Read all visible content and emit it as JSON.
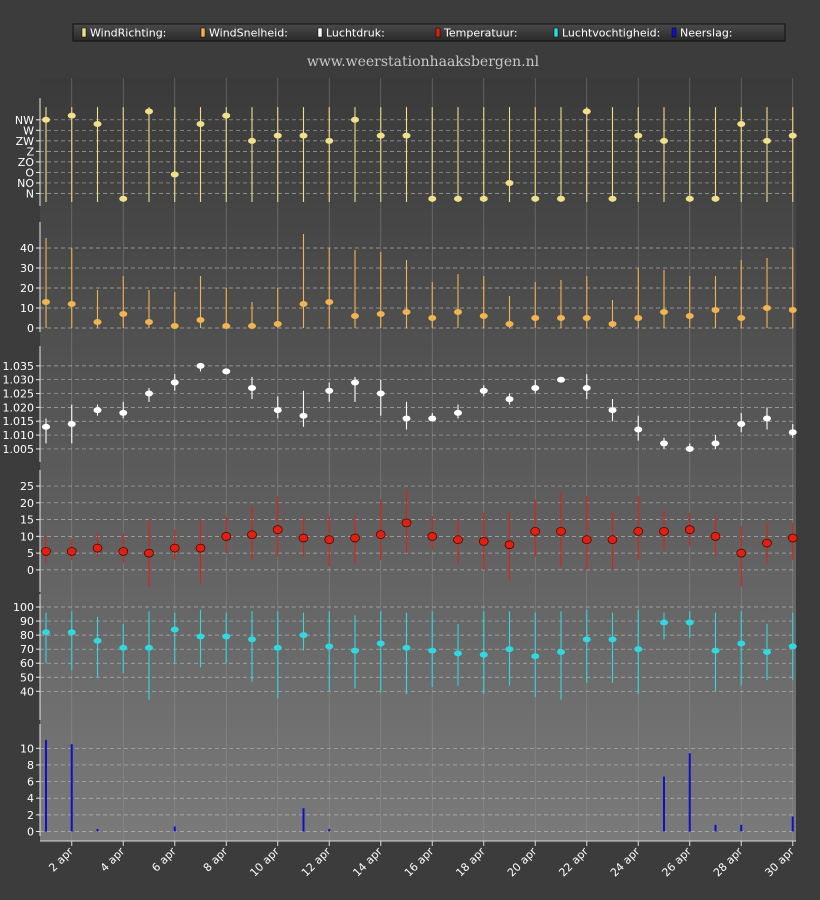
{
  "site_title": "www.weerstationhaaksbergen.nl",
  "legend": [
    {
      "label": "WindRichting:",
      "color": "#f0e08a"
    },
    {
      "label": "WindSnelheid:",
      "color": "#f2b450"
    },
    {
      "label": "Luchtdruk:",
      "color": "#ffffff"
    },
    {
      "label": "Temperatuur:",
      "color": "#e02010"
    },
    {
      "label": "Luchtvochtigheid:",
      "color": "#30d8e0"
    },
    {
      "label": "Neerslag:",
      "color": "#1010c8"
    }
  ],
  "chart_data": [
    {
      "type": "scatter",
      "name": "WindRichting",
      "x": [
        1,
        2,
        3,
        4,
        5,
        6,
        7,
        8,
        9,
        10,
        11,
        12,
        13,
        14,
        15,
        16,
        17,
        18,
        19,
        20,
        21,
        22,
        23,
        24,
        25,
        26,
        27,
        28,
        29,
        30
      ],
      "y_categories": [
        "N",
        "NO",
        "O",
        "ZO",
        "Z",
        "ZW",
        "W",
        "NW"
      ],
      "values": [
        7.0,
        7.4,
        6.6,
        -0.5,
        7.8,
        1.8,
        6.6,
        7.4,
        5.0,
        5.5,
        5.5,
        5.0,
        7.0,
        5.5,
        5.5,
        -0.5,
        -0.5,
        -0.5,
        1.0,
        -0.5,
        -0.5,
        7.8,
        -0.5,
        5.5,
        5.0,
        -0.5,
        -0.5,
        6.6,
        5.0,
        5.5
      ],
      "ylim": [
        -1,
        8.5
      ],
      "color": "#f0e08a"
    },
    {
      "type": "scatter",
      "name": "WindSnelheid",
      "x": [
        1,
        2,
        3,
        4,
        5,
        6,
        7,
        8,
        9,
        10,
        11,
        12,
        13,
        14,
        15,
        16,
        17,
        18,
        19,
        20,
        21,
        22,
        23,
        24,
        25,
        26,
        27,
        28,
        29,
        30
      ],
      "values": [
        13,
        12,
        3,
        7,
        3,
        1,
        4,
        1,
        1,
        2,
        12,
        13,
        6,
        7,
        8,
        5,
        8,
        6,
        2,
        5,
        5,
        5,
        2,
        5,
        8,
        6,
        9,
        5,
        10,
        9
      ],
      "highs": [
        45,
        40,
        19,
        26,
        19,
        18,
        26,
        20,
        13,
        20,
        47,
        40,
        39,
        38,
        34,
        23,
        27,
        26,
        16,
        23,
        24,
        26,
        14,
        30,
        29,
        26,
        26,
        34,
        35,
        40
      ],
      "lows": [
        0,
        0,
        0,
        0,
        0,
        0,
        0,
        0,
        0,
        0,
        0,
        0,
        0,
        0,
        0,
        0,
        0,
        0,
        0,
        0,
        0,
        0,
        0,
        0,
        0,
        0,
        0,
        0,
        0,
        0
      ],
      "yticks": [
        0,
        10,
        20,
        30,
        40
      ],
      "ylim": [
        -1,
        50
      ],
      "color": "#f2b450"
    },
    {
      "type": "scatter",
      "name": "Luchtdruk",
      "x": [
        1,
        2,
        3,
        4,
        5,
        6,
        7,
        8,
        9,
        10,
        11,
        12,
        13,
        14,
        15,
        16,
        17,
        18,
        19,
        20,
        21,
        22,
        23,
        24,
        25,
        26,
        27,
        28,
        29,
        30
      ],
      "values": [
        1.013,
        1.014,
        1.019,
        1.018,
        1.025,
        1.029,
        1.035,
        1.033,
        1.027,
        1.019,
        1.017,
        1.026,
        1.029,
        1.025,
        1.016,
        1.016,
        1.018,
        1.026,
        1.023,
        1.027,
        1.03,
        1.027,
        1.019,
        1.012,
        1.007,
        1.005,
        1.007,
        1.014,
        1.016,
        1.011
      ],
      "highs": [
        1.016,
        1.021,
        1.021,
        1.022,
        1.027,
        1.032,
        1.036,
        1.034,
        1.031,
        1.024,
        1.026,
        1.029,
        1.031,
        1.03,
        1.022,
        1.018,
        1.021,
        1.028,
        1.025,
        1.03,
        1.031,
        1.032,
        1.023,
        1.017,
        1.009,
        1.007,
        1.01,
        1.018,
        1.02,
        1.014
      ],
      "lows": [
        1.007,
        1.007,
        1.017,
        1.016,
        1.022,
        1.026,
        1.033,
        1.032,
        1.023,
        1.016,
        1.013,
        1.022,
        1.022,
        1.017,
        1.012,
        1.015,
        1.016,
        1.024,
        1.021,
        1.025,
        1.029,
        1.023,
        1.015,
        1.008,
        1.005,
        1.004,
        1.005,
        1.011,
        1.012,
        1.009
      ],
      "yticks": [
        1.005,
        1.01,
        1.015,
        1.02,
        1.025,
        1.03,
        1.035
      ],
      "ylim": [
        1.001,
        1.04
      ],
      "color": "#ffffff"
    },
    {
      "type": "scatter",
      "name": "Temperatuur",
      "x": [
        1,
        2,
        3,
        4,
        5,
        6,
        7,
        8,
        9,
        10,
        11,
        12,
        13,
        14,
        15,
        16,
        17,
        18,
        19,
        20,
        21,
        22,
        23,
        24,
        25,
        26,
        27,
        28,
        29,
        30
      ],
      "values": [
        5.5,
        5.5,
        6.5,
        5.5,
        5,
        6.5,
        6.5,
        10,
        10.5,
        12,
        9.5,
        9,
        9.5,
        10.5,
        14,
        10,
        9,
        8.5,
        7.5,
        11.5,
        11.5,
        9,
        9,
        11.5,
        11.5,
        12,
        10,
        5,
        8,
        9.5
      ],
      "highs": [
        10,
        9,
        11,
        11,
        15,
        12,
        15,
        16,
        19,
        22,
        16,
        16,
        16,
        21,
        24,
        16,
        15,
        17,
        17,
        21,
        23,
        22,
        17,
        22,
        18,
        17,
        16,
        13,
        14,
        14
      ],
      "lows": [
        2,
        3,
        4,
        2,
        -5,
        3,
        -4,
        5,
        3,
        4,
        4,
        1,
        2,
        3,
        5,
        6,
        2,
        0,
        -3,
        4,
        1,
        0,
        0,
        3,
        6,
        7,
        4,
        -5,
        2,
        3
      ],
      "yticks": [
        0,
        5,
        10,
        15,
        20,
        25
      ],
      "ylim": [
        -6,
        28
      ],
      "color": "#e02010"
    },
    {
      "type": "scatter",
      "name": "Luchtvochtigheid",
      "x": [
        1,
        2,
        3,
        4,
        5,
        6,
        7,
        8,
        9,
        10,
        11,
        12,
        13,
        14,
        15,
        16,
        17,
        18,
        19,
        20,
        21,
        22,
        23,
        24,
        25,
        26,
        27,
        28,
        29,
        30
      ],
      "values": [
        82,
        82,
        76,
        71,
        71,
        84,
        79,
        79,
        77,
        71,
        80,
        72,
        69,
        74,
        71,
        69,
        67,
        66,
        70,
        65,
        68,
        77,
        77,
        70,
        89,
        89,
        69,
        74,
        68,
        72
      ],
      "highs": [
        96,
        97,
        93,
        88,
        97,
        96,
        98,
        96,
        97,
        97,
        96,
        97,
        94,
        97,
        96,
        97,
        88,
        97,
        97,
        96,
        97,
        98,
        96,
        98,
        96,
        97,
        96,
        97,
        88,
        96
      ],
      "lows": [
        60,
        55,
        50,
        53,
        34,
        60,
        57,
        60,
        47,
        35,
        69,
        40,
        42,
        39,
        38,
        43,
        44,
        38,
        44,
        36,
        34,
        46,
        46,
        38,
        77,
        78,
        40,
        44,
        48,
        48
      ],
      "yticks": [
        40,
        50,
        60,
        70,
        80,
        90,
        100
      ],
      "ylim": [
        21,
        105
      ],
      "color": "#30d8e0"
    },
    {
      "type": "bar",
      "name": "Neerslag",
      "x": [
        1,
        2,
        3,
        4,
        5,
        6,
        7,
        8,
        9,
        10,
        11,
        12,
        13,
        14,
        15,
        16,
        17,
        18,
        19,
        20,
        21,
        22,
        23,
        24,
        25,
        26,
        27,
        28,
        29,
        30
      ],
      "values": [
        11,
        10.5,
        0.3,
        0,
        0,
        0.6,
        0,
        0,
        0,
        0,
        2.8,
        0.3,
        0,
        0,
        0,
        0,
        0,
        0,
        0,
        0,
        0,
        0,
        0,
        0,
        6.6,
        9.4,
        0.8,
        0.8,
        0,
        1.8
      ],
      "yticks": [
        0,
        2,
        4,
        6,
        8,
        10
      ],
      "ylim": [
        -0.3,
        12.2
      ],
      "color": "#1010c8"
    }
  ],
  "x_tick_labels": [
    "2 apr",
    "4 apr",
    "6 apr",
    "8 apr",
    "10 apr",
    "12 apr",
    "14 apr",
    "16 apr",
    "18 apr",
    "20 apr",
    "22 apr",
    "24 apr",
    "26 apr",
    "28 apr",
    "30 apr"
  ],
  "x_tick_days": [
    2,
    4,
    6,
    8,
    10,
    12,
    14,
    16,
    18,
    20,
    22,
    24,
    26,
    28,
    30
  ]
}
